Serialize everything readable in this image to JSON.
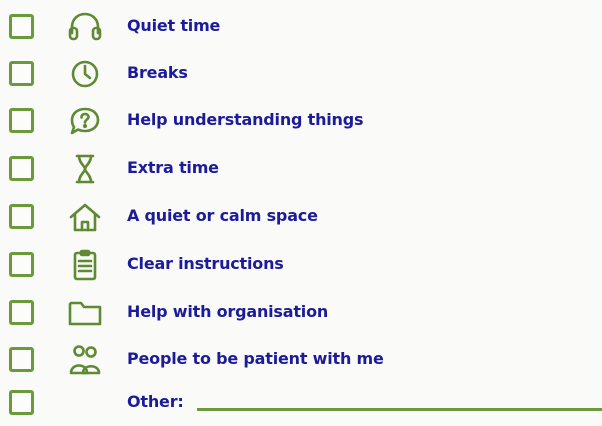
{
  "items": [
    {
      "label": "Quiet time",
      "icon": "headphones-icon"
    },
    {
      "label": "Breaks",
      "icon": "clock-icon"
    },
    {
      "label": "Help understanding things",
      "icon": "question-speech-bubble-icon"
    },
    {
      "label": "Extra time",
      "icon": "hourglass-icon"
    },
    {
      "label": "A quiet or calm space",
      "icon": "house-icon"
    },
    {
      "label": "Clear instructions",
      "icon": "clipboard-list-icon"
    },
    {
      "label": "Help with organisation",
      "icon": "folder-icon"
    },
    {
      "label": "People to be patient with me",
      "icon": "people-icon"
    }
  ],
  "other": {
    "label": "Other:",
    "value": ""
  },
  "colors": {
    "checkbox_border": "#6b9a3a",
    "icon_stroke": "#5e8a33",
    "label_text": "#1c1c9a",
    "background": "#fafaf9"
  }
}
